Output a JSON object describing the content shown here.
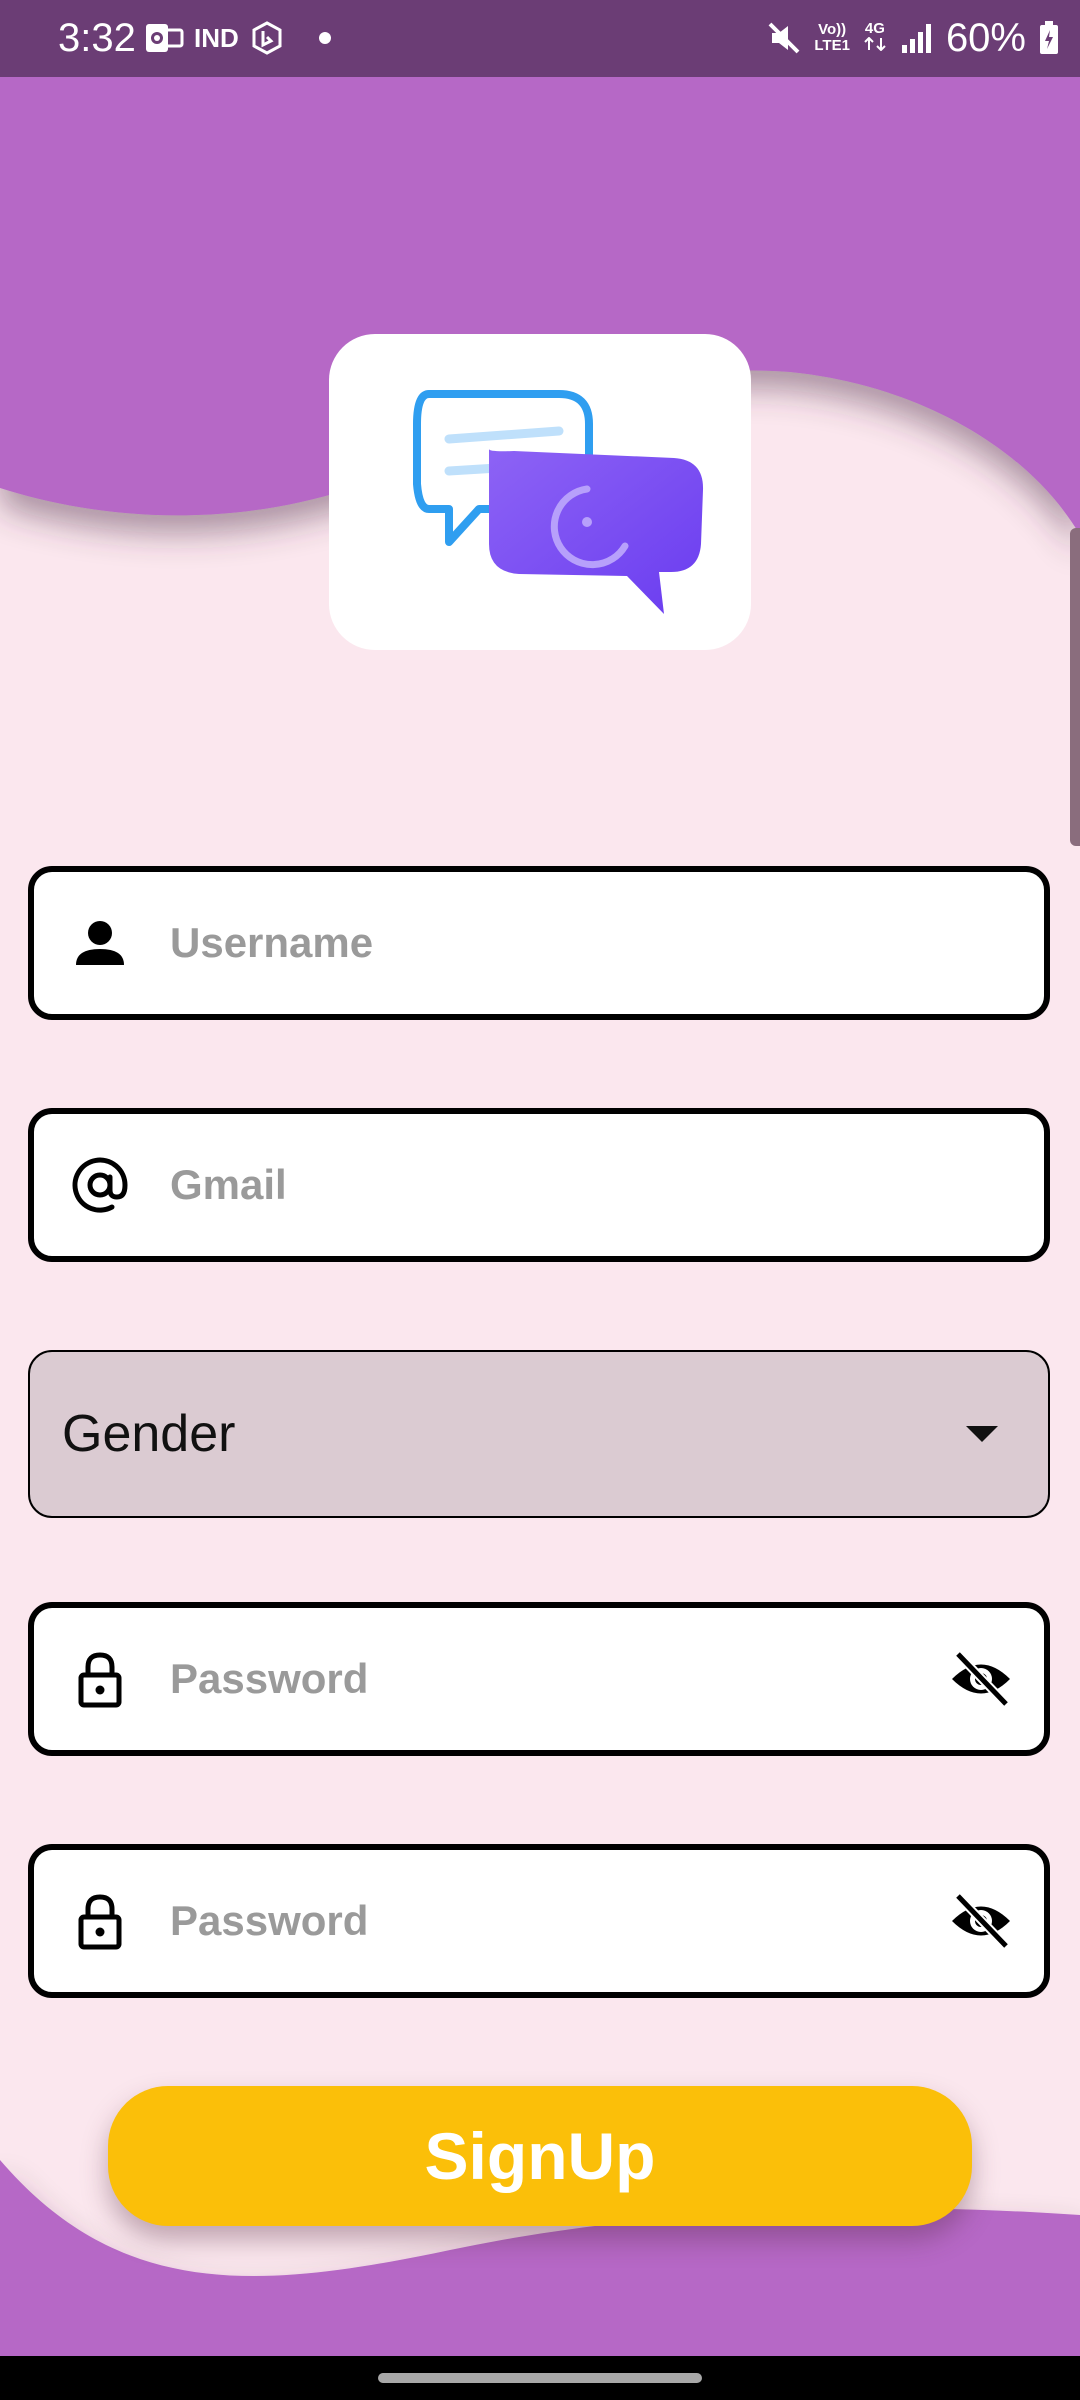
{
  "status_bar": {
    "time": "3:32",
    "carrier_badge": "IND",
    "network_label_top": "Vo))",
    "network_label_bottom": "LTE1",
    "network_type": "4G",
    "battery": "60%",
    "icons": [
      "outlook-icon",
      "bing-icon",
      "dot-icon",
      "mute-icon",
      "signal-icon",
      "battery-icon"
    ]
  },
  "logo": {
    "icon": "chat-bubbles-icon"
  },
  "form": {
    "username_placeholder": "Username",
    "gmail_placeholder": "Gmail",
    "gender_label": "Gender",
    "password_placeholder": "Password",
    "confirm_password_placeholder": "Password"
  },
  "signup_label": "SignUp",
  "colors": {
    "status_bar": "#6b3d75",
    "header_purple": "#b668c6",
    "page_background": "#fbe7ee",
    "button_yellow": "#fbbf09",
    "dropdown_fill": "#dbcbd2"
  }
}
